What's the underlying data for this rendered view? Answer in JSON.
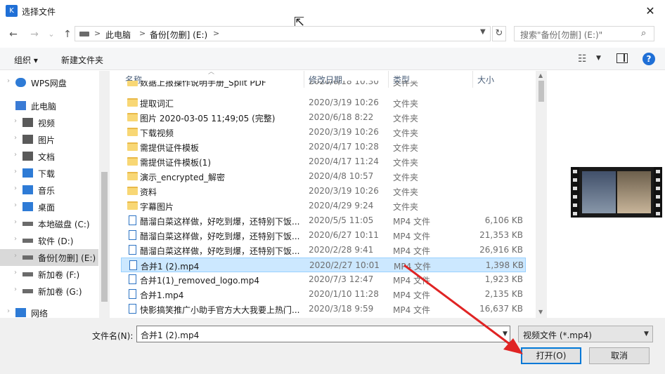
{
  "window": {
    "title": "选择文件",
    "close_glyph": "✕",
    "app_icon_glyph": "K"
  },
  "nav": {
    "back_glyph": "←",
    "forward_glyph": "→",
    "recent_glyph": "⌄",
    "up_glyph": "↑",
    "refresh_glyph": "↻",
    "search_glyph": "⌕"
  },
  "address": {
    "crumbs": [
      "此电脑",
      "备份[勿删] (E:)"
    ],
    "sep": ">"
  },
  "search": {
    "placeholder": "搜索\"备份[勿删] (E:)\""
  },
  "toolbar": {
    "organize": "组织 ▾",
    "new_folder": "新建文件夹",
    "view_glyph": "☷",
    "dd_glyph": "▼",
    "help_glyph": "?"
  },
  "navpane": {
    "items": [
      {
        "label": "WPS网盘",
        "icon": "cloud-icon"
      },
      {
        "label": "此电脑",
        "icon": "computer-icon"
      },
      {
        "label": "视频",
        "icon": "video-folder-icon"
      },
      {
        "label": "图片",
        "icon": "pictures-folder-icon"
      },
      {
        "label": "文档",
        "icon": "documents-folder-icon"
      },
      {
        "label": "下载",
        "icon": "download-icon"
      },
      {
        "label": "音乐",
        "icon": "music-icon"
      },
      {
        "label": "桌面",
        "icon": "desktop-icon"
      },
      {
        "label": "本地磁盘 (C:)",
        "icon": "drive-icon"
      },
      {
        "label": "软件 (D:)",
        "icon": "drive-icon"
      },
      {
        "label": "备份[勿删] (E:)",
        "icon": "drive-icon"
      },
      {
        "label": "新加卷 (F:)",
        "icon": "drive-icon"
      },
      {
        "label": "新加卷 (G:)",
        "icon": "drive-icon"
      },
      {
        "label": "网络",
        "icon": "network-icon"
      }
    ]
  },
  "columns": {
    "name": "名称",
    "date": "修改日期",
    "type": "类型",
    "size": "大小"
  },
  "files": [
    {
      "name": "数据上报操作说明手册_Split PDF",
      "date": "2020/6/18 10:30",
      "type": "文件夹",
      "size": "",
      "kind": "folder"
    },
    {
      "name": "提取词汇",
      "date": "2020/3/19 10:26",
      "type": "文件夹",
      "size": "",
      "kind": "folder"
    },
    {
      "name": "图片 2020-03-05 11;49;05 (完整)",
      "date": "2020/6/18 8:22",
      "type": "文件夹",
      "size": "",
      "kind": "folder"
    },
    {
      "name": "下载视频",
      "date": "2020/3/19 10:26",
      "type": "文件夹",
      "size": "",
      "kind": "folder"
    },
    {
      "name": "需提供证件模板",
      "date": "2020/4/17 10:28",
      "type": "文件夹",
      "size": "",
      "kind": "folder"
    },
    {
      "name": "需提供证件模板(1)",
      "date": "2020/4/17 11:24",
      "type": "文件夹",
      "size": "",
      "kind": "folder"
    },
    {
      "name": "演示_encrypted_解密",
      "date": "2020/4/8 10:57",
      "type": "文件夹",
      "size": "",
      "kind": "folder"
    },
    {
      "name": "资料",
      "date": "2020/3/19 10:26",
      "type": "文件夹",
      "size": "",
      "kind": "folder"
    },
    {
      "name": "字幕图片",
      "date": "2020/4/29 9:24",
      "type": "文件夹",
      "size": "",
      "kind": "folder"
    },
    {
      "name": "醋溜白菜这样做，好吃到爆，还特别下饭...",
      "date": "2020/5/5 11:05",
      "type": "MP4 文件",
      "size": "6,106 KB",
      "kind": "doc"
    },
    {
      "name": "醋溜白菜这样做，好吃到爆，还特别下饭...",
      "date": "2020/6/27 10:11",
      "type": "MP4 文件",
      "size": "21,353 KB",
      "kind": "doc"
    },
    {
      "name": "醋溜白菜这样做，好吃到爆，还特别下饭...",
      "date": "2020/2/28 9:41",
      "type": "MP4 文件",
      "size": "26,916 KB",
      "kind": "doc"
    },
    {
      "name": "合并1 (2).mp4",
      "date": "2020/2/27 10:01",
      "type": "MP4 文件",
      "size": "1,398 KB",
      "kind": "doc",
      "selected": true
    },
    {
      "name": "合并1(1)_removed_logo.mp4",
      "date": "2020/7/3 12:47",
      "type": "MP4 文件",
      "size": "1,923 KB",
      "kind": "doc"
    },
    {
      "name": "合并1.mp4",
      "date": "2020/1/10 11:28",
      "type": "MP4 文件",
      "size": "2,135 KB",
      "kind": "doc"
    },
    {
      "name": "快影搞笑推广小助手官方大大我要上热门...",
      "date": "2020/3/18 9:59",
      "type": "MP4 文件",
      "size": "16,637 KB",
      "kind": "doc"
    }
  ],
  "bottom": {
    "filename_label": "文件名(N):",
    "filename_value": "合并1 (2).mp4",
    "filter_value": "视频文件 (*.mp4)",
    "open_label": "打开(O)",
    "cancel_label": "取消"
  },
  "colors": {
    "accent": "#0078d7",
    "selection": "#cce8ff",
    "annotation_arrow": "#e02424"
  }
}
